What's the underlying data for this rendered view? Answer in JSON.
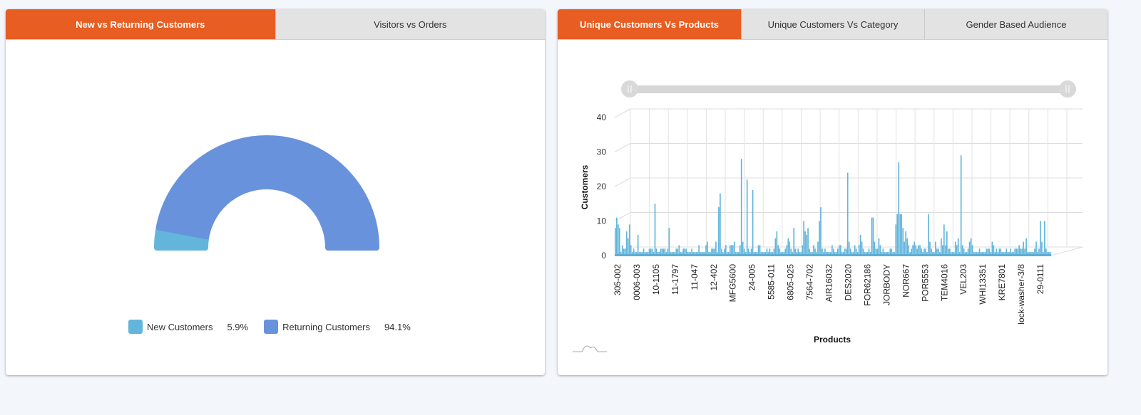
{
  "left_panel": {
    "tabs": [
      {
        "label": "New vs Returning Customers",
        "active": true
      },
      {
        "label": "Visitors vs Orders",
        "active": false
      }
    ],
    "legend": [
      {
        "label": "New Customers",
        "value": "5.9%",
        "color": "#63b5dc"
      },
      {
        "label": "Returning Customers",
        "value": "94.1%",
        "color": "#6893dc"
      }
    ]
  },
  "right_panel": {
    "tabs": [
      {
        "label": "Unique Customers Vs Products",
        "active": true
      },
      {
        "label": "Unique Customers Vs Category",
        "active": false
      },
      {
        "label": "Gender Based Audience",
        "active": false
      }
    ]
  },
  "colors": {
    "accent": "#e85d22",
    "tab_inactive": "#e3e3e3",
    "bar": "#63b5dc"
  },
  "chart_data": [
    {
      "type": "pie",
      "subtype": "semi-donut",
      "title": "New vs Returning Customers",
      "categories": [
        "New Customers",
        "Returning Customers"
      ],
      "values": [
        5.9,
        94.1
      ],
      "colors": [
        "#63b5dc",
        "#6893dc"
      ]
    },
    {
      "type": "bar",
      "title": "Unique Customers Vs Products",
      "xlabel": "Products",
      "ylabel": "Customers",
      "ylim": [
        0,
        40
      ],
      "yticks": [
        0,
        10,
        20,
        30,
        40
      ],
      "grid": true,
      "tick_labels": [
        "305-002",
        "0006-003",
        "10-1105",
        "11-1797",
        "11-047",
        "12-402",
        "MFG5600",
        "24-005",
        "5585-011",
        "6805-025",
        "7564-702",
        "AIR16032",
        "DES2020",
        "FOR62186",
        "JORBODY",
        "NOR667",
        "POR5553",
        "TEM4016",
        "VEL203",
        "WHI13351",
        "KRE7801",
        "lock-washer-3/8",
        "29-0111"
      ],
      "values": [
        8,
        11,
        9,
        8,
        1,
        3,
        2,
        2,
        7,
        5,
        9,
        3,
        1,
        2,
        1,
        1,
        6,
        1,
        1,
        1,
        2,
        1,
        1,
        1,
        2,
        2,
        2,
        1,
        15,
        2,
        1,
        1,
        2,
        2,
        2,
        2,
        1,
        2,
        8,
        1,
        1,
        1,
        1,
        2,
        2,
        3,
        1,
        1,
        2,
        2,
        2,
        1,
        1,
        1,
        2,
        1,
        1,
        1,
        1,
        3,
        1,
        1,
        1,
        1,
        3,
        4,
        1,
        1,
        2,
        2,
        2,
        4,
        1,
        14,
        18,
        2,
        1,
        2,
        3,
        1,
        1,
        3,
        3,
        3,
        4,
        1,
        1,
        1,
        3,
        28,
        4,
        2,
        1,
        22,
        2,
        1,
        2,
        19,
        1,
        1,
        1,
        3,
        3,
        1,
        1,
        1,
        1,
        2,
        1,
        2,
        1,
        1,
        2,
        5,
        7,
        3,
        2,
        1,
        1,
        1,
        2,
        3,
        5,
        4,
        2,
        1,
        8,
        2,
        1,
        2,
        1,
        1,
        3,
        10,
        7,
        6,
        8,
        2,
        1,
        1,
        3,
        2,
        1,
        4,
        10,
        14,
        2,
        1,
        2,
        1,
        1,
        1,
        1,
        3,
        2,
        1,
        1,
        2,
        3,
        3,
        1,
        1,
        2,
        2,
        24,
        4,
        2,
        1,
        1,
        3,
        2,
        1,
        3,
        6,
        4,
        2,
        1,
        1,
        1,
        2,
        1,
        11,
        11,
        4,
        2,
        2,
        5,
        3,
        1,
        2,
        1,
        1,
        1,
        1,
        2,
        2,
        1,
        1,
        9,
        12,
        27,
        12,
        12,
        8,
        4,
        7,
        5,
        3,
        1,
        2,
        3,
        4,
        3,
        2,
        3,
        3,
        2,
        1,
        2,
        2,
        1,
        12,
        4,
        2,
        1,
        1,
        4,
        2,
        2,
        1,
        5,
        3,
        9,
        3,
        7,
        2,
        2,
        1,
        1,
        1,
        4,
        3,
        5,
        1,
        29,
        3,
        2,
        1,
        1,
        2,
        4,
        5,
        3,
        1,
        1,
        1,
        1,
        2,
        1,
        1,
        1,
        1,
        2,
        2,
        2,
        1,
        4,
        3,
        1,
        2,
        1,
        2,
        2,
        1,
        1,
        1,
        2,
        1,
        1,
        2,
        1,
        1,
        2,
        2,
        2,
        3,
        2,
        2,
        4,
        2,
        5,
        1,
        1,
        1,
        1,
        1,
        2,
        4,
        1,
        2,
        10,
        4,
        1,
        10,
        2,
        1,
        1,
        1
      ]
    }
  ],
  "zoom_slider": {
    "start": 0,
    "end": 1
  }
}
